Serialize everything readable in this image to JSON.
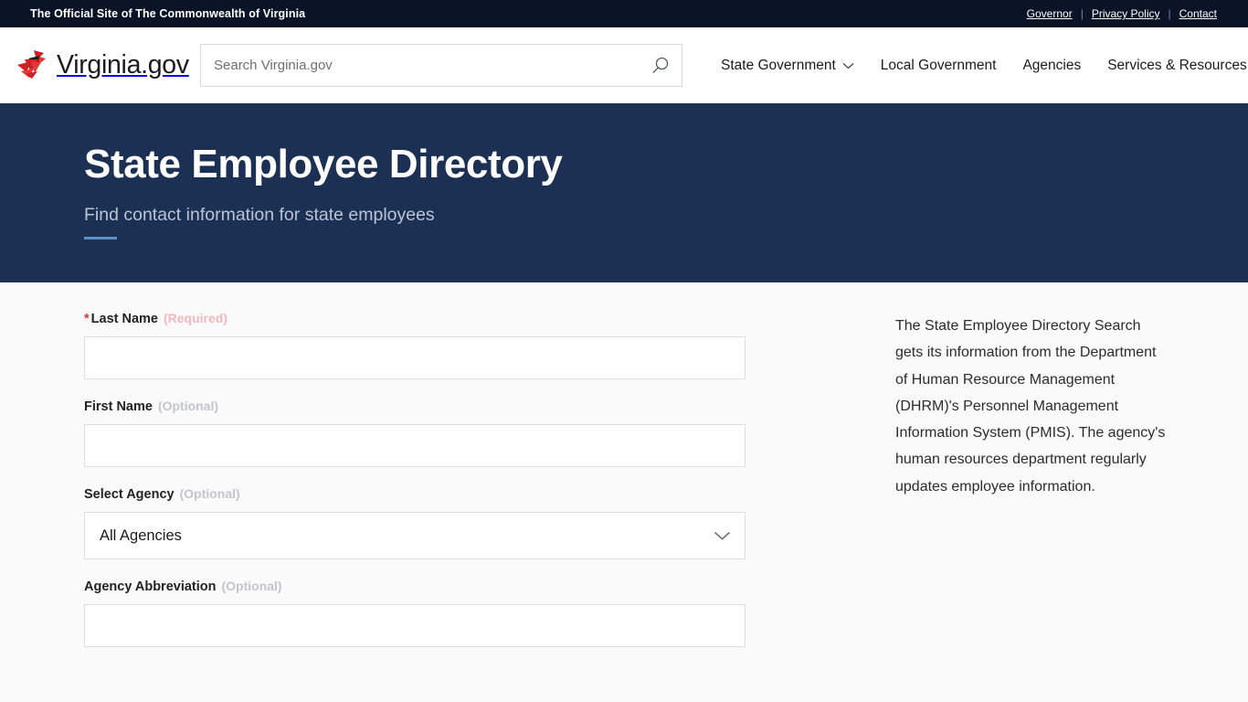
{
  "topbar": {
    "title": "The Official Site of The Commonwealth of Virginia",
    "separator": "|",
    "links": [
      {
        "label": "Governor"
      },
      {
        "label": "Privacy Policy"
      },
      {
        "label": "Contact"
      }
    ]
  },
  "masthead": {
    "brand_name": "Virginia.gov",
    "logo_icon": "cardinal-logo-icon",
    "search": {
      "placeholder": "Search Virginia.gov",
      "value": "",
      "icon": "search-icon"
    },
    "nav": [
      {
        "label": "State Government",
        "has_dropdown": true,
        "icon": "chevron-down-icon"
      },
      {
        "label": "Local Government",
        "has_dropdown": false
      },
      {
        "label": "Agencies",
        "has_dropdown": false
      },
      {
        "label": "Services & Resources",
        "has_dropdown": false
      }
    ]
  },
  "hero": {
    "title": "State Employee Directory",
    "subtitle": "Find contact information for state employees"
  },
  "form": {
    "fields": [
      {
        "label": "Last Name",
        "required_marker": "*",
        "tag": "(Required)",
        "tag_kind": "required",
        "type": "text",
        "value": "",
        "placeholder": ""
      },
      {
        "label": "First Name",
        "required_marker": "",
        "tag": "(Optional)",
        "tag_kind": "optional",
        "type": "text",
        "value": "",
        "placeholder": ""
      },
      {
        "label": "Select Agency",
        "required_marker": "",
        "tag": "(Optional)",
        "tag_kind": "optional",
        "type": "select",
        "value": "All Agencies",
        "icon": "chevron-down-icon"
      },
      {
        "label": "Agency Abbreviation",
        "required_marker": "",
        "tag": "(Optional)",
        "tag_kind": "optional",
        "type": "text",
        "value": "",
        "placeholder": ""
      }
    ]
  },
  "sidebar": {
    "paragraph": "The State Employee Directory Search gets its information from the Department of Human Resource Management (DHRM)'s Personnel Management Information System (PMIS). The agency's human resources department regularly updates employee information."
  },
  "colors": {
    "topbar_bg": "#0b1326",
    "hero_bg": "#1c3054",
    "hero_accent": "#5b90c4",
    "page_bg": "#fafafa",
    "brand_red": "#cf2027",
    "required_tag": "#f2b9bb",
    "optional_tag": "#c3c5c9",
    "asterisk": "#d0393e"
  }
}
